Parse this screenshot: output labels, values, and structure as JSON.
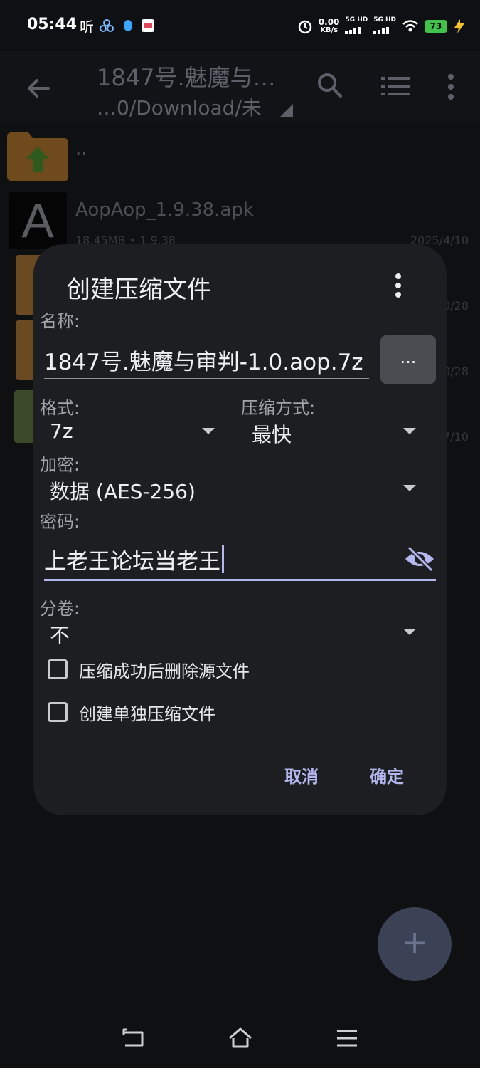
{
  "status_bar": {
    "time": "05:44",
    "listen_label": "听",
    "speed_value": "0.00",
    "speed_unit": "KB/s",
    "net1": "5G HD",
    "net2": "5G HD",
    "battery": "73"
  },
  "app_bar": {
    "title": "1847号.魅魔与…",
    "subtitle": "…0/Download/未"
  },
  "files": [
    {
      "name": "..",
      "meta": "",
      "date": ""
    },
    {
      "name": "AopAop_1.9.38.apk",
      "meta": "18.45MB  • 1.9.38",
      "date": "2025/4/10",
      "icon_letter": "A"
    },
    {
      "name": "",
      "meta": "",
      "date": "0/28"
    },
    {
      "name": "",
      "meta": "",
      "date": "0/28"
    },
    {
      "name": "",
      "meta": "",
      "date": "7/10"
    }
  ],
  "dialog": {
    "title": "创建压缩文件",
    "name_label": "名称:",
    "name_value": "1847号.魅魔与审判-1.0.aop.7z",
    "browse_label": "...",
    "format_label": "格式:",
    "format_value": "7z",
    "compression_label": "压缩方式:",
    "compression_value": "最快",
    "encryption_label": "加密:",
    "encryption_value": "数据 (AES-256)",
    "password_label": "密码:",
    "password_value": "上老王论坛当老王",
    "split_label": "分卷:",
    "split_value": "不",
    "delete_source_label": "压缩成功后删除源文件",
    "separate_archive_label": "创建单独压缩文件",
    "cancel_label": "取消",
    "ok_label": "确定"
  },
  "fab_label": "+",
  "colors": {
    "accent": "#b3b7ee",
    "dialog_bg": "#1d1e22",
    "page_bg": "#0f1012"
  }
}
